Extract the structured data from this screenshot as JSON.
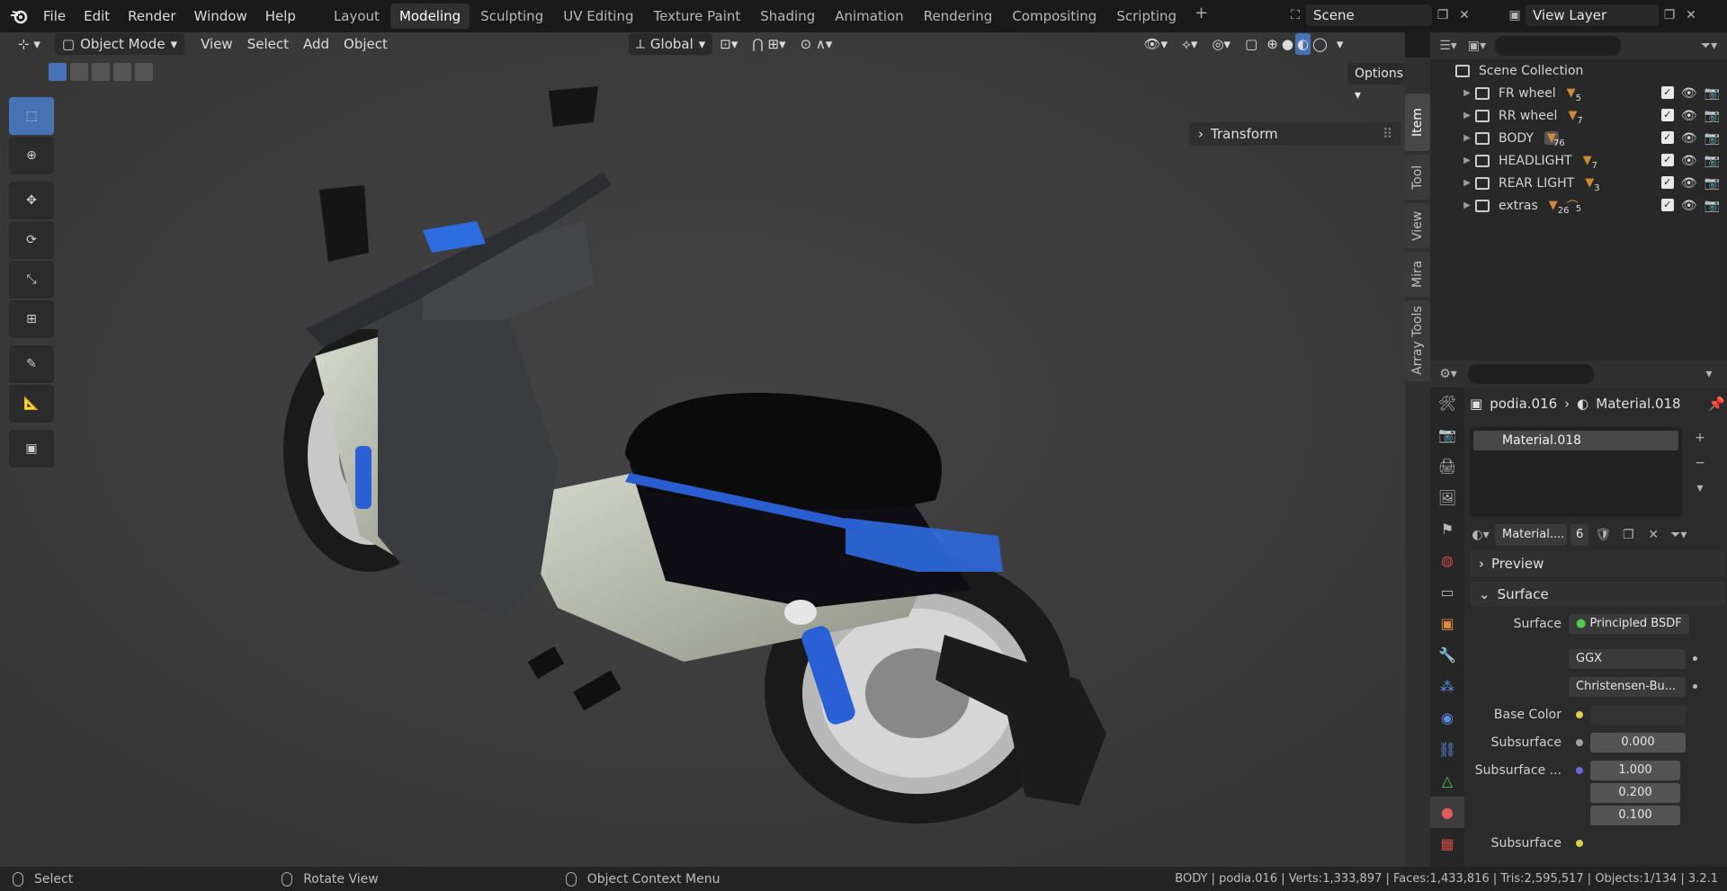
{
  "menu": [
    "File",
    "Edit",
    "Render",
    "Window",
    "Help"
  ],
  "workspaces": [
    "Layout",
    "Modeling",
    "Sculpting",
    "UV Editing",
    "Texture Paint",
    "Shading",
    "Animation",
    "Rendering",
    "Compositing",
    "Scripting"
  ],
  "active_workspace": "Modeling",
  "scene_name": "Scene",
  "view_layer": "View Layer",
  "viewport": {
    "mode": "Object Mode",
    "menus": [
      "View",
      "Select",
      "Add",
      "Object"
    ],
    "orientation": "Global",
    "options": "Options",
    "transform": "Transform",
    "ntabs": [
      "Item",
      "Tool",
      "View",
      "Mira",
      "Array Tools"
    ]
  },
  "outliner": {
    "root": "Scene Collection",
    "rows": [
      {
        "name": "FR wheel",
        "count": "5"
      },
      {
        "name": "RR wheel",
        "count": "7"
      },
      {
        "name": "BODY",
        "count": "76"
      },
      {
        "name": "HEADLIGHT",
        "count": "7"
      },
      {
        "name": "REAR LIGHT",
        "count": "3"
      },
      {
        "name": "extras",
        "count": "26",
        "count2": "5"
      }
    ]
  },
  "properties": {
    "object": "podia.016",
    "material": "Material.018",
    "slot": "Material.018",
    "mat_field": "Material....",
    "users": "6",
    "preview": "Preview",
    "surface_section": "Surface",
    "surface_label": "Surface",
    "shader": "Principled BSDF",
    "distribution": "GGX",
    "subsurface_method": "Christensen-Bu...",
    "base_color": "Base Color",
    "subsurface": "Subsurface",
    "subsurface_value": "0.000",
    "subsurface_radius": "Subsurface ...",
    "radius": [
      "1.000",
      "0.200",
      "0.100"
    ],
    "cut": "Subsurface"
  },
  "status": {
    "select": "Select",
    "rotate": "Rotate View",
    "context": "Object Context Menu",
    "info": "BODY | podia.016 | Verts:1,333,897 | Faces:1,433,816 | Tris:2,595,517 | Objects:1/134 | 3.2.1"
  }
}
